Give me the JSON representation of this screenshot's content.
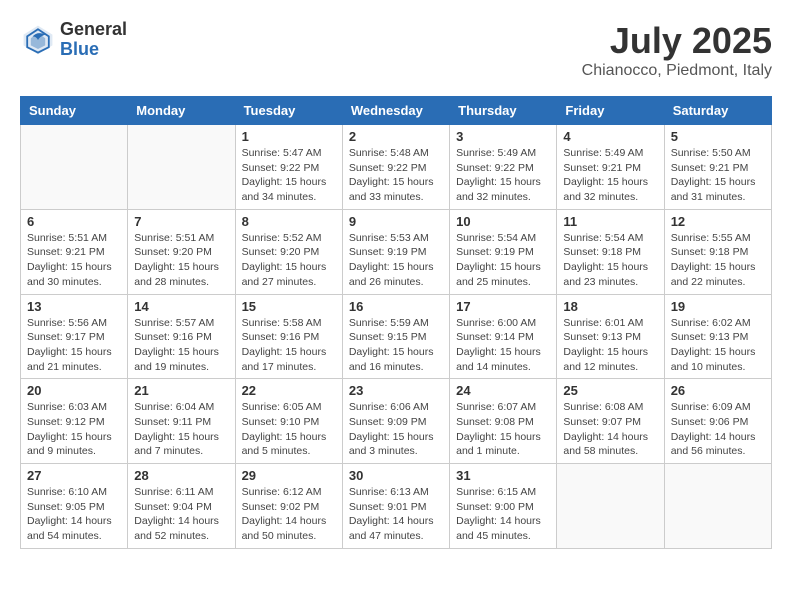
{
  "logo": {
    "general": "General",
    "blue": "Blue"
  },
  "title": "July 2025",
  "location": "Chianocco, Piedmont, Italy",
  "days_of_week": [
    "Sunday",
    "Monday",
    "Tuesday",
    "Wednesday",
    "Thursday",
    "Friday",
    "Saturday"
  ],
  "weeks": [
    [
      {
        "day": "",
        "info": ""
      },
      {
        "day": "",
        "info": ""
      },
      {
        "day": "1",
        "info": "Sunrise: 5:47 AM\nSunset: 9:22 PM\nDaylight: 15 hours and 34 minutes."
      },
      {
        "day": "2",
        "info": "Sunrise: 5:48 AM\nSunset: 9:22 PM\nDaylight: 15 hours and 33 minutes."
      },
      {
        "day": "3",
        "info": "Sunrise: 5:49 AM\nSunset: 9:22 PM\nDaylight: 15 hours and 32 minutes."
      },
      {
        "day": "4",
        "info": "Sunrise: 5:49 AM\nSunset: 9:21 PM\nDaylight: 15 hours and 32 minutes."
      },
      {
        "day": "5",
        "info": "Sunrise: 5:50 AM\nSunset: 9:21 PM\nDaylight: 15 hours and 31 minutes."
      }
    ],
    [
      {
        "day": "6",
        "info": "Sunrise: 5:51 AM\nSunset: 9:21 PM\nDaylight: 15 hours and 30 minutes."
      },
      {
        "day": "7",
        "info": "Sunrise: 5:51 AM\nSunset: 9:20 PM\nDaylight: 15 hours and 28 minutes."
      },
      {
        "day": "8",
        "info": "Sunrise: 5:52 AM\nSunset: 9:20 PM\nDaylight: 15 hours and 27 minutes."
      },
      {
        "day": "9",
        "info": "Sunrise: 5:53 AM\nSunset: 9:19 PM\nDaylight: 15 hours and 26 minutes."
      },
      {
        "day": "10",
        "info": "Sunrise: 5:54 AM\nSunset: 9:19 PM\nDaylight: 15 hours and 25 minutes."
      },
      {
        "day": "11",
        "info": "Sunrise: 5:54 AM\nSunset: 9:18 PM\nDaylight: 15 hours and 23 minutes."
      },
      {
        "day": "12",
        "info": "Sunrise: 5:55 AM\nSunset: 9:18 PM\nDaylight: 15 hours and 22 minutes."
      }
    ],
    [
      {
        "day": "13",
        "info": "Sunrise: 5:56 AM\nSunset: 9:17 PM\nDaylight: 15 hours and 21 minutes."
      },
      {
        "day": "14",
        "info": "Sunrise: 5:57 AM\nSunset: 9:16 PM\nDaylight: 15 hours and 19 minutes."
      },
      {
        "day": "15",
        "info": "Sunrise: 5:58 AM\nSunset: 9:16 PM\nDaylight: 15 hours and 17 minutes."
      },
      {
        "day": "16",
        "info": "Sunrise: 5:59 AM\nSunset: 9:15 PM\nDaylight: 15 hours and 16 minutes."
      },
      {
        "day": "17",
        "info": "Sunrise: 6:00 AM\nSunset: 9:14 PM\nDaylight: 15 hours and 14 minutes."
      },
      {
        "day": "18",
        "info": "Sunrise: 6:01 AM\nSunset: 9:13 PM\nDaylight: 15 hours and 12 minutes."
      },
      {
        "day": "19",
        "info": "Sunrise: 6:02 AM\nSunset: 9:13 PM\nDaylight: 15 hours and 10 minutes."
      }
    ],
    [
      {
        "day": "20",
        "info": "Sunrise: 6:03 AM\nSunset: 9:12 PM\nDaylight: 15 hours and 9 minutes."
      },
      {
        "day": "21",
        "info": "Sunrise: 6:04 AM\nSunset: 9:11 PM\nDaylight: 15 hours and 7 minutes."
      },
      {
        "day": "22",
        "info": "Sunrise: 6:05 AM\nSunset: 9:10 PM\nDaylight: 15 hours and 5 minutes."
      },
      {
        "day": "23",
        "info": "Sunrise: 6:06 AM\nSunset: 9:09 PM\nDaylight: 15 hours and 3 minutes."
      },
      {
        "day": "24",
        "info": "Sunrise: 6:07 AM\nSunset: 9:08 PM\nDaylight: 15 hours and 1 minute."
      },
      {
        "day": "25",
        "info": "Sunrise: 6:08 AM\nSunset: 9:07 PM\nDaylight: 14 hours and 58 minutes."
      },
      {
        "day": "26",
        "info": "Sunrise: 6:09 AM\nSunset: 9:06 PM\nDaylight: 14 hours and 56 minutes."
      }
    ],
    [
      {
        "day": "27",
        "info": "Sunrise: 6:10 AM\nSunset: 9:05 PM\nDaylight: 14 hours and 54 minutes."
      },
      {
        "day": "28",
        "info": "Sunrise: 6:11 AM\nSunset: 9:04 PM\nDaylight: 14 hours and 52 minutes."
      },
      {
        "day": "29",
        "info": "Sunrise: 6:12 AM\nSunset: 9:02 PM\nDaylight: 14 hours and 50 minutes."
      },
      {
        "day": "30",
        "info": "Sunrise: 6:13 AM\nSunset: 9:01 PM\nDaylight: 14 hours and 47 minutes."
      },
      {
        "day": "31",
        "info": "Sunrise: 6:15 AM\nSunset: 9:00 PM\nDaylight: 14 hours and 45 minutes."
      },
      {
        "day": "",
        "info": ""
      },
      {
        "day": "",
        "info": ""
      }
    ]
  ]
}
